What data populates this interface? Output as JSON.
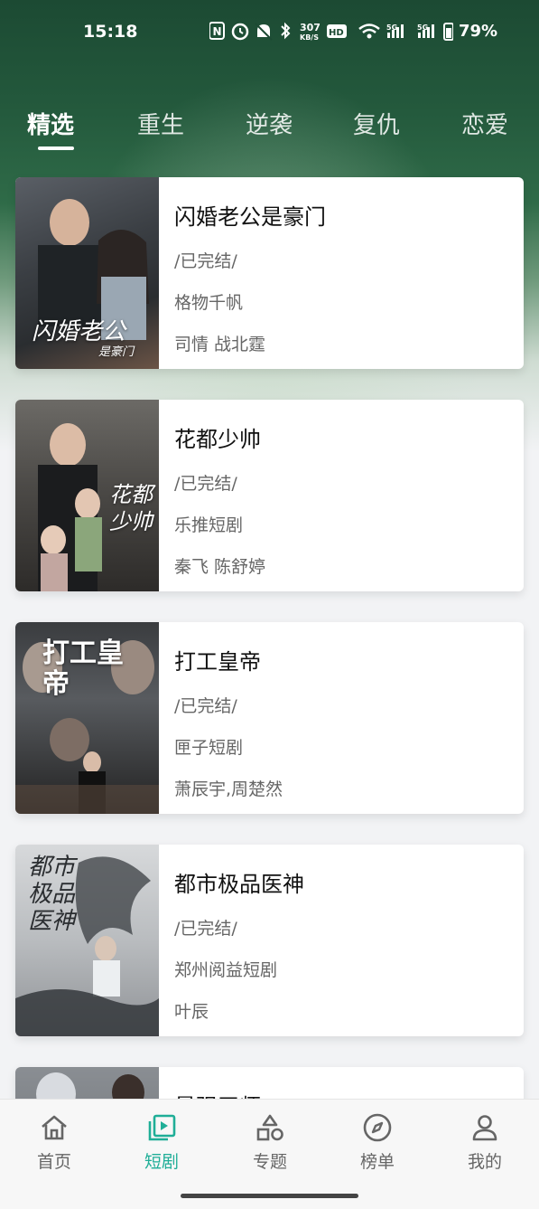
{
  "status_bar": {
    "time": "15:18",
    "network_speed": "307 KB/S",
    "signal_1": "5G",
    "signal_2": "5G",
    "battery": "79%"
  },
  "tabs": [
    {
      "label": "精选",
      "active": true
    },
    {
      "label": "重生",
      "active": false
    },
    {
      "label": "逆袭",
      "active": false
    },
    {
      "label": "复仇",
      "active": false
    },
    {
      "label": "恋爱",
      "active": false
    }
  ],
  "dramas": [
    {
      "title": "闪婚老公是豪门",
      "status": "/已完结/",
      "producer": "格物千帆",
      "cast": "司情 战北霆",
      "cover_text": "闪婚老公",
      "cover_subtext": "是豪门"
    },
    {
      "title": "花都少帅",
      "status": "/已完结/",
      "producer": "乐推短剧",
      "cast": "秦飞  陈舒婷",
      "cover_text": "花都少帅"
    },
    {
      "title": "打工皇帝",
      "status": "/已完结/",
      "producer": "匣子短剧",
      "cast": "萧辰宇,周楚然",
      "cover_text": "打工皇帝"
    },
    {
      "title": "都市极品医神",
      "status": "/已完结/",
      "producer": "郑州阅益短剧",
      "cast": "叶辰",
      "cover_text": "都市极品医神"
    },
    {
      "title": "最强王师",
      "status": "",
      "producer": "",
      "cast": ""
    }
  ],
  "bottom_nav": [
    {
      "label": "首页",
      "icon": "home-icon",
      "active": false
    },
    {
      "label": "短剧",
      "icon": "play-icon",
      "active": true
    },
    {
      "label": "专题",
      "icon": "shapes-icon",
      "active": false
    },
    {
      "label": "榜单",
      "icon": "compass-icon",
      "active": false
    },
    {
      "label": "我的",
      "icon": "person-icon",
      "active": false
    }
  ],
  "colors": {
    "accent": "#1fae97",
    "header_green": "#245a3d"
  }
}
